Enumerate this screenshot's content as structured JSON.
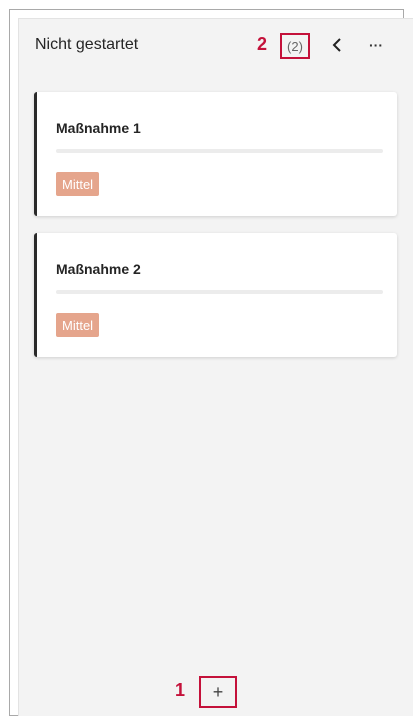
{
  "column": {
    "title": "Nicht gestartet",
    "count": "(2)",
    "more_glyph": "···",
    "collapse_icon": "chevron-left-icon",
    "more_icon": "ellipsis-icon"
  },
  "annotations": {
    "callout_count": "2",
    "callout_add": "1",
    "callout_color": "#c4113a"
  },
  "cards": [
    {
      "title": "Maßnahme 1",
      "priority": "Mittel",
      "progress_fraction": 0.0
    },
    {
      "title": "Maßnahme 2",
      "priority": "Mittel",
      "progress_fraction": 0.0
    }
  ],
  "footer": {
    "add_glyph": "+",
    "add_icon": "plus-icon"
  },
  "colors": {
    "priority_badge": "#e5a58c",
    "card_accent": "#2a2a2a",
    "column_bg": "#f3f3f3"
  }
}
